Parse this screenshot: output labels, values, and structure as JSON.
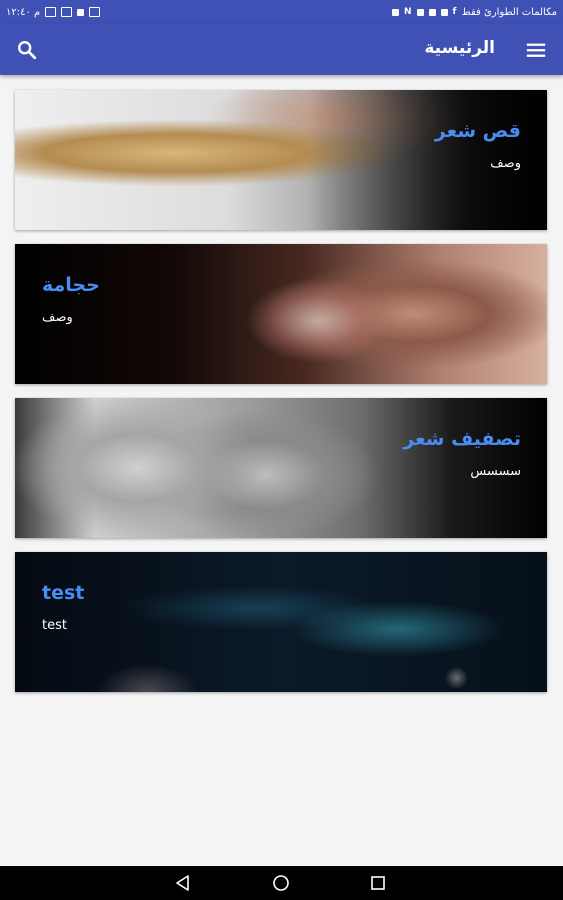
{
  "status_bar": {
    "left_text": "م ١٢:٤٠",
    "right_text": "مكالمات الطوارئ فقط"
  },
  "app_bar": {
    "title": "الرئيسية",
    "search_icon": "search-icon",
    "menu_icon": "hamburger-menu-icon"
  },
  "cards": [
    {
      "title": "قص شعر",
      "description": "وصف",
      "align": "right",
      "image": "hair-cutting-photo"
    },
    {
      "title": "حجامة",
      "description": "وصف",
      "align": "left",
      "image": "cupping-photo"
    },
    {
      "title": "تصفيف شعر",
      "description": "سسسس",
      "align": "right",
      "image": "hair-styling-photo"
    },
    {
      "title": "test",
      "description": "test",
      "align": "left",
      "image": "space-photo"
    }
  ],
  "nav_bar": {
    "back_icon": "back-triangle-icon",
    "home_icon": "home-circle-icon",
    "recents_icon": "recents-square-icon"
  },
  "colors": {
    "primary": "#3f51b5",
    "card_title": "#4a8cf0",
    "background": "#f4f4f4"
  }
}
